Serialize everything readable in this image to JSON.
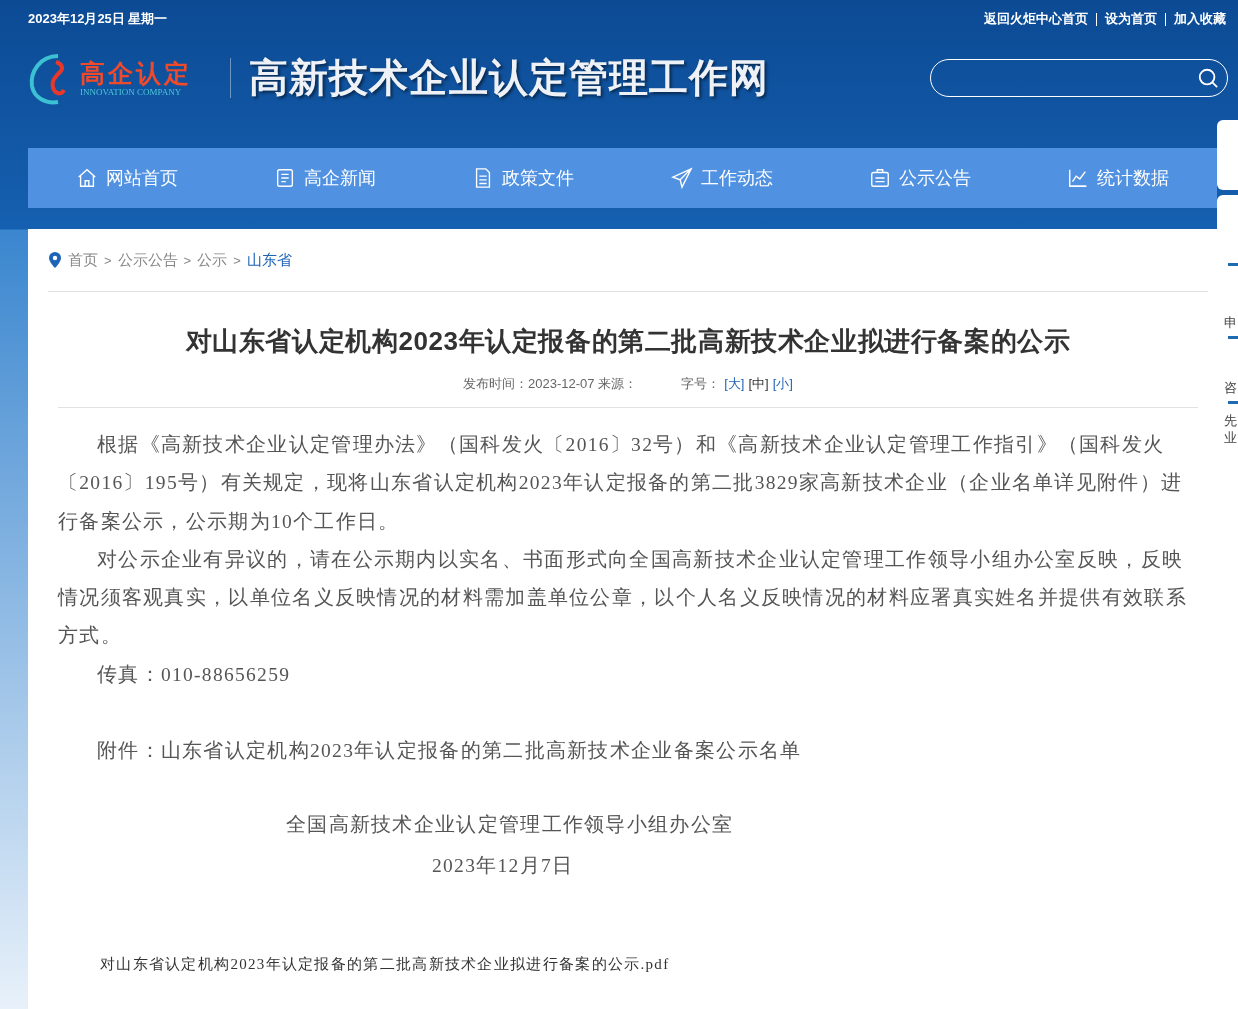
{
  "top_bar": {
    "date": "2023年12月25日 星期一",
    "links": [
      "返回火炬中心首页",
      "设为首页",
      "加入收藏"
    ]
  },
  "logo": {
    "name": "高企认定",
    "subtitle": "INNOVATION COMPANY"
  },
  "site_title": "高新技术企业认定管理工作网",
  "nav": [
    {
      "label": "网站首页",
      "kind": "home"
    },
    {
      "label": "高企新闻",
      "kind": "news"
    },
    {
      "label": "政策文件",
      "kind": "doc"
    },
    {
      "label": "工作动态",
      "kind": "send"
    },
    {
      "label": "公示公告",
      "kind": "board"
    },
    {
      "label": "统计数据",
      "kind": "chart"
    }
  ],
  "breadcrumb_separator": ">",
  "breadcrumb": [
    {
      "label": "首页",
      "selected": false
    },
    {
      "label": "公示公告",
      "selected": false
    },
    {
      "label": "公示",
      "selected": false
    },
    {
      "label": "山东省",
      "selected": true
    }
  ],
  "article": {
    "title": "对山东省认定机构2023年认定报备的第二批高新技术企业拟进行备案的公示",
    "meta": "发布时间：2023-12-07 来源：",
    "font_size_label": "字号：",
    "font_sizes": [
      {
        "label": "[大]",
        "selected": false
      },
      {
        "label": "[中]",
        "selected": true
      },
      {
        "label": "[小]",
        "selected": false
      }
    ],
    "paragraphs": [
      {
        "kind": "indent",
        "text": "根据《高新技术企业认定管理办法》（国科发火〔2016〕32号）和《高新技术企业认定管理工作指引》（国科发火〔2016〕195号）有关规定，现将山东省认定机构2023年认定报备的第二批3829家高新技术企业（企业名单详见附件）进行备案公示，公示期为10个工作日。"
      },
      {
        "kind": "indent",
        "text": "对公示企业有异议的，请在公示期内以实名、书面形式向全国高新技术企业认定管理工作领导小组办公室反映，反映情况须客观真实，以单位名义反映情况的材料需加盖单位公章，以个人名义反映情况的材料应署真实姓名并提供有效联系方式。"
      },
      {
        "kind": "indent",
        "text": "传真：010-88656259"
      },
      {
        "kind": "spaced",
        "text": "附件：山东省认定机构2023年认定报备的第二批高新技术企业备案公示名单"
      }
    ],
    "signature": "全国高新技术企业认定管理工作领导小组办公室",
    "sign_date": "2023年12月7日",
    "attachment": "对山东省认定机构2023年认定报备的第二批高新技术企业拟进行备案的公示.pdf"
  },
  "side_panel": [
    "申",
    "咨",
    "先业"
  ]
}
